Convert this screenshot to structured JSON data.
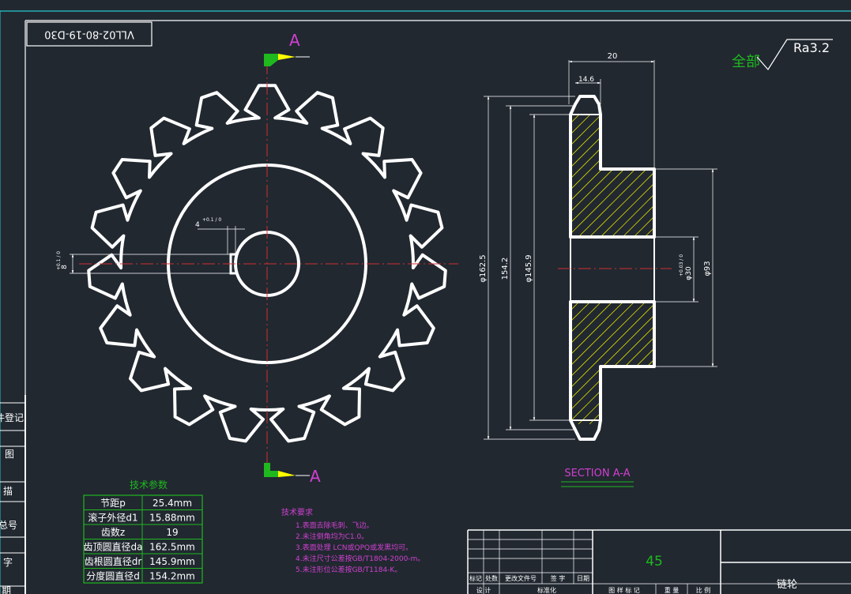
{
  "drawing_number": "VLL02-80-19-D30",
  "material": "45",
  "part_name": "链轮",
  "roughness": {
    "prefix": "全部",
    "value": "Ra3.2"
  },
  "section_marks": {
    "top": "A",
    "bottom": "A"
  },
  "section_title": "SECTION A-A",
  "keyway_dims": {
    "width": "4",
    "width_tol": "+0.1 / 0",
    "depth": "8",
    "depth_tol": "+0.1 / 0"
  },
  "section_dims": {
    "width_total": "20",
    "tooth_width": "14.6",
    "d_outer": "φ162.5",
    "d_pitch": "154.2",
    "d_root": "φ145.9",
    "d_bore": "φ30",
    "bore_tol": "+0.03 / 0",
    "d_hub": "φ93"
  },
  "tech_params": {
    "title": "技术参数",
    "rows": [
      {
        "label": "节距p",
        "value": "25.4mm"
      },
      {
        "label": "滚子外径d1",
        "value": "15.88mm"
      },
      {
        "label": "齿数z",
        "value": "19"
      },
      {
        "label": "齿顶圆直径da",
        "value": "162.5mm"
      },
      {
        "label": "齿根圆直径dr",
        "value": "145.9mm"
      },
      {
        "label": "分度圆直径d",
        "value": "154.2mm"
      }
    ]
  },
  "tech_requirements": {
    "title": "技术要求",
    "items": [
      "1.表面去除毛刺、飞边。",
      "2.未注倒角均为C1.0。",
      "3.表面处理 LCN或QPQ或发黑均可。",
      "4.未注尺寸公差按GB/T1804-2000-m。",
      "5.未注形位公差按GB/T1184-K。"
    ]
  },
  "title_block": {
    "row_labels": [
      "标记",
      "处数",
      "更改文件号",
      "签 字",
      "日期"
    ],
    "bottom_labels": [
      "设 计",
      "标准化",
      "图 样 标 记",
      "重 量",
      "比 例"
    ]
  },
  "left_strip": [
    "件登记",
    "图",
    "描",
    "底图总号",
    "签 字",
    "期"
  ]
}
